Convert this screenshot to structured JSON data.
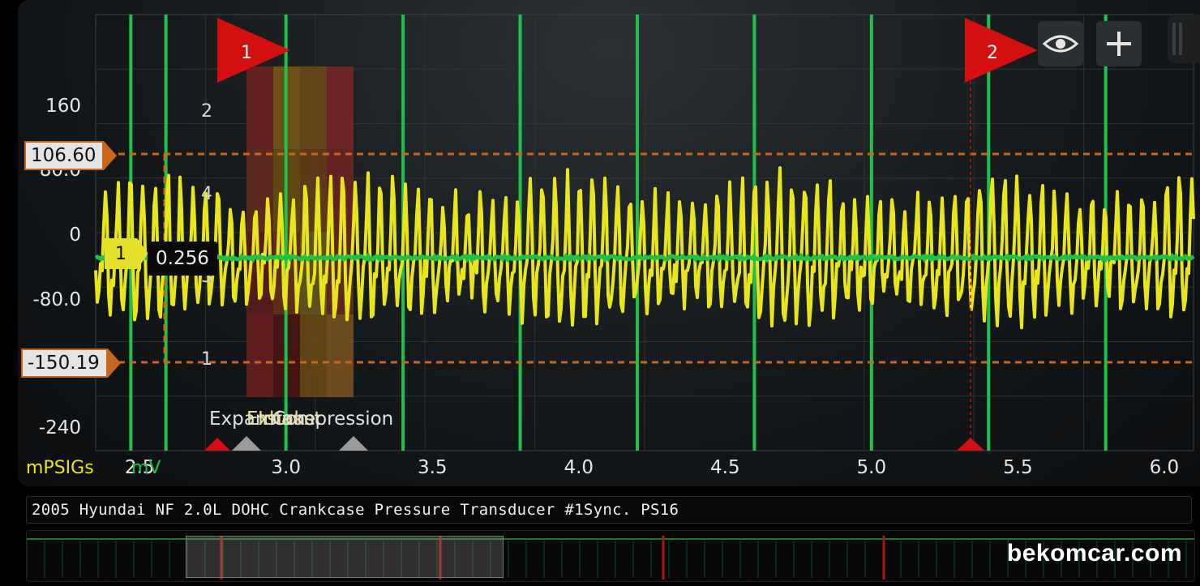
{
  "title": "2005 Hyundai NF 2.0L DOHC Crankcase Pressure Transducer #1Sync. PS16",
  "watermark": "bekomcar.com",
  "units": {
    "left": "mPSIGs",
    "right": "mV"
  },
  "y_ticks_mpsig": [
    "160",
    "80.0",
    "0",
    "-80.0",
    "-240"
  ],
  "x_ticks": [
    "2.5",
    "3.0",
    "3.5",
    "4.0",
    "4.5",
    "5.0",
    "5.5",
    "6.0"
  ],
  "cylinder_ticks": [
    "2",
    "4",
    "3",
    "1"
  ],
  "hlines": {
    "upper": "106.60",
    "lower": "-150.19"
  },
  "channel_marker": {
    "label": "1",
    "value": "0.256"
  },
  "cursors": [
    {
      "label": "1"
    },
    {
      "label": "2"
    }
  ],
  "strokes": [
    "Expansion",
    "Exhaust",
    "Intake",
    "Compression"
  ],
  "icons": {
    "eye": "eye-icon",
    "plus": "plus-icon"
  },
  "colors": {
    "yellow": "#e8e51c",
    "green": "#1ec24a",
    "orange": "#c8661a",
    "cursor_red": "#d40f0f",
    "unit_yellow": "#e8e51c",
    "unit_green": "#1ec24a"
  },
  "chart_data": {
    "type": "line",
    "xlabel": "",
    "ylabel": "",
    "x_range": [
      2.35,
      6.1
    ],
    "ylim_mpsig": [
      -240,
      200
    ],
    "series": [
      {
        "name": "mPSIGs",
        "color": "#e8e51c",
        "peak": 106.6,
        "trough": -150.19
      },
      {
        "name": "mV",
        "color": "#1ec24a"
      }
    ],
    "sync_lines_x": [
      2.47,
      2.59,
      3.0,
      3.4,
      3.8,
      4.2,
      4.6,
      5.0,
      5.4,
      5.8
    ]
  }
}
